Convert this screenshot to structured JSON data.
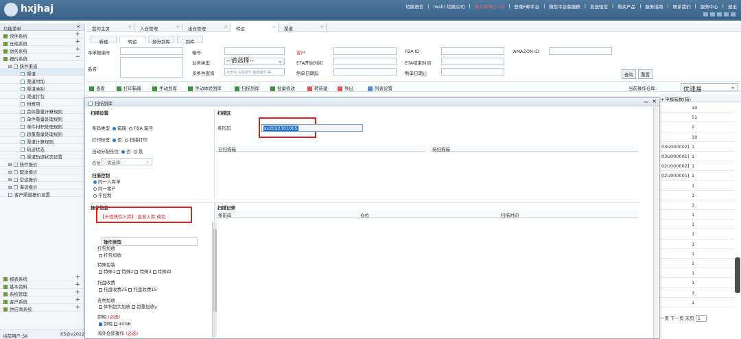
{
  "app": {
    "brand": "hxjhaj"
  },
  "topnav": {
    "items": [
      "切换语言",
      "(wsh) 切换公司",
      "未入库中心 (3)",
      "登录E邮平台",
      "微信平台客服群",
      "发送短信",
      "购买产品",
      "服务指南",
      "联系我们",
      "服务中心",
      "退出"
    ]
  },
  "sidebar": {
    "title": "功能菜单",
    "collapse": "«",
    "groups": [
      {
        "label": "快件系统",
        "sign": "+"
      },
      {
        "label": "仓储系统",
        "sign": "+"
      },
      {
        "label": "财务系统",
        "sign": "+"
      },
      {
        "label": "报价系统",
        "sign": "−"
      }
    ],
    "tree_parent": "快件渠道",
    "tree_items": [
      "渠道",
      "渠道附加",
      "渠道类别",
      "渠道打包",
      "附费项",
      "首续重量计算规则",
      "单件重量处理规则",
      "单件材积处理规则",
      "超重重量处理规则",
      "渠道计算规则",
      "轨迹状态",
      "渠道轨迹状态设置"
    ],
    "tree_more": [
      "快件报价",
      "配送报价",
      "空运报价",
      "海运报价"
    ],
    "tree_last": "客户渠道报价设置",
    "bottom_groups": [
      {
        "label": "报表系统",
        "sign": "+"
      },
      {
        "label": "基本资料",
        "sign": "+"
      },
      {
        "label": "系统管理",
        "sign": "+"
      },
      {
        "label": "客户系统",
        "sign": "+"
      },
      {
        "label": "供应商系统",
        "sign": "+"
      }
    ],
    "current_user": "当前用户:SK",
    "status_text": "K5@v2022"
  },
  "tabs": [
    {
      "label": "我的主页"
    },
    {
      "label": "入仓管理"
    },
    {
      "label": "出仓管理"
    },
    {
      "label": "转运"
    },
    {
      "label": "渠道"
    }
  ],
  "subtabs": [
    "新建",
    "转运",
    "部分到库",
    "到库"
  ],
  "filters": {
    "order_no": "本单据编号",
    "order_no2": "箱号",
    "customer": "客户",
    "fba_id": "FBA ID",
    "amazon_id": "AMAZON ID",
    "product_name": "品名",
    "biz_type": "业务类型",
    "select_placeholder": "--请选择--",
    "eta_start": "ETA开始时间",
    "eta_end": "ETA结束时间",
    "multi_query": "多条件查询",
    "multi_placeholder": "可查询 头程单号 箱唛编号 等",
    "create_from": "制单日期起",
    "create_to": "制单日期止",
    "search_btn": "查询",
    "reset_btn": "重置"
  },
  "toolbar": {
    "items": [
      "查看",
      "打印箱唛",
      "手动到库",
      "手动体验到库",
      "扫描到库",
      "批量修改",
      "转新建",
      "导出",
      "列表设置"
    ],
    "warehouse_label": "当前操作仓库:",
    "warehouse_value": "优速易"
  },
  "right_grid": {
    "header": "申报箱数(箱)",
    "rows": [
      {
        "code": "",
        "value": "10"
      },
      {
        "code": "",
        "value": "51"
      },
      {
        "code": "",
        "value": "2"
      },
      {
        "code": "",
        "value": "10"
      },
      {
        "code": "03U000002]",
        "value": "1"
      },
      {
        "code": "03U000001]",
        "value": "1"
      },
      {
        "code": "02U000002]",
        "value": "1"
      },
      {
        "code": "02U000001]",
        "value": "1"
      },
      {
        "code": "",
        "value": "1"
      },
      {
        "code": "",
        "value": "1"
      },
      {
        "code": "",
        "value": "1"
      },
      {
        "code": "",
        "value": "1"
      },
      {
        "code": "",
        "value": "1"
      },
      {
        "code": "",
        "value": "1"
      },
      {
        "code": "",
        "value": "1"
      },
      {
        "code": "",
        "value": "1"
      },
      {
        "code": "",
        "value": "1"
      },
      {
        "code": "",
        "value": "1"
      },
      {
        "code": "",
        "value": "1"
      },
      {
        "code": "",
        "value": "1"
      },
      {
        "code": "",
        "value": "1"
      }
    ],
    "pager": {
      "prev": "一页",
      "next": "下一页",
      "last": "末页",
      "page": "1"
    }
  },
  "modal": {
    "title": "扫描到库",
    "settings_title": "扫描设置",
    "barcode_type_label": "条码类型",
    "opt_box": "箱唛",
    "opt_fba": "FBA 箱号",
    "print_label": "打印标签",
    "opt_no": "否",
    "opt_print_now": "扫描打印",
    "auto_pos_label": "自动分配仓位",
    "opt_no2": "否",
    "opt_yes2": "是",
    "position_label": "仓位",
    "position_placeholder": "--请选择--",
    "scan_control_title": "扫描控制",
    "ctrl1": "同一入库单",
    "ctrl2": "同一客户",
    "ctrl3": "不控制",
    "info_title": "操作信息",
    "info_text": "【头程快件入库】-直发入库 成功",
    "op_type_title": "操作类型",
    "pack_title": "打包加收",
    "pack_opt": "打包加收",
    "special_title": "特殊包装",
    "special_opts": [
      "特殊1",
      "特殊2",
      "特殊3",
      "特殊四"
    ],
    "pallet_title": "托盘收费",
    "pallet_opts": [
      "托盘收费25",
      "托盘收费15"
    ],
    "extra_title": "各种加收",
    "extra_opts": [
      "体积超大加收",
      "超重加收y"
    ],
    "box_title": "卸柜",
    "required": "(必选)",
    "box_opts": [
      "卸柜",
      "40GB"
    ],
    "last_title": "海外仓卸操作",
    "scan_area_title": "扫描区",
    "barcode_label": "条形码",
    "barcode_value": "sx2022301005",
    "scanned_label": "已扫描箱",
    "to_scan_label": "待扫描箱",
    "records_title": "扫描记录",
    "col_barcode": "条形码",
    "col_position": "仓位",
    "col_time": "扫描时间"
  }
}
